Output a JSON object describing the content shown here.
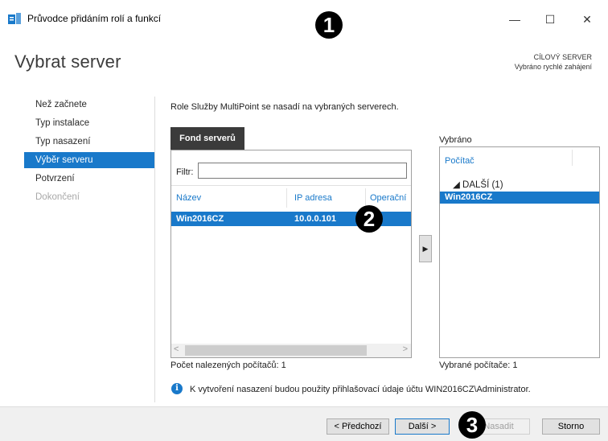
{
  "window": {
    "title": "Průvodce přidáním rolí a funkcí",
    "minimize": "—",
    "maximize": "☐",
    "close": "✕",
    "icon": "server-manager-icon"
  },
  "header": {
    "page_title": "Vybrat server",
    "destination_label": "CÍLOVÝ SERVER",
    "destination_value": "Vybráno rychlé zahájení"
  },
  "nav": {
    "items": [
      {
        "label": "Než začnete",
        "state": "normal"
      },
      {
        "label": "Typ instalace",
        "state": "normal"
      },
      {
        "label": "Typ nasazení",
        "state": "normal"
      },
      {
        "label": "Výběr serveru",
        "state": "active"
      },
      {
        "label": "Potvrzení",
        "state": "normal"
      },
      {
        "label": "Dokončení",
        "state": "disabled"
      }
    ]
  },
  "content": {
    "intro": "Role Služby MultiPoint se nasadí na vybraných serverech.",
    "pool_tab": "Fond serverů",
    "filter_label": "Filtr:",
    "filter_value": "",
    "columns": [
      "Název",
      "IP adresa",
      "Operační"
    ],
    "rows": [
      {
        "name": "Win2016CZ",
        "ip": "10.0.0.101",
        "os": ""
      }
    ],
    "scroll_left": "<",
    "scroll_right": ">",
    "found_count": "Počet nalezených počítačů: 1",
    "add_button": "▶",
    "selected_label": "Vybráno",
    "selected_column": "Počítač",
    "selected_group": "◢  DALŠÍ (1)",
    "selected_item": "Win2016CZ",
    "selected_count": "Vybrané počítače: 1",
    "info_icon_glyph": "i",
    "info_text": "K vytvoření nasazení budou použity přihlašovací údaje účtu WIN2016CZ\\Administrator."
  },
  "buttons": {
    "previous": "< Předchozí",
    "next": "Další >",
    "deploy": "Nasadit",
    "cancel": "Storno"
  },
  "markers": [
    "1",
    "2",
    "3"
  ],
  "colors": {
    "accent": "#1979ca",
    "tab_dark": "#3b3b3b",
    "footer_bg": "#f0f0f0"
  }
}
